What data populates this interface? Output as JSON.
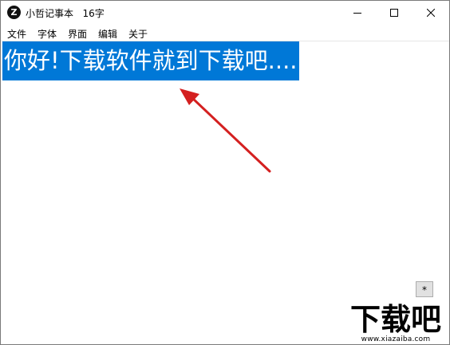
{
  "window": {
    "icon_letter": "Z",
    "title": "小哲记事本",
    "char_count": "16字"
  },
  "menu": [
    "文件",
    "字体",
    "界面",
    "编辑",
    "关于"
  ],
  "editor": {
    "selected_text": "你好!下载软件就到下载吧...."
  },
  "star_button": {
    "label": "*"
  },
  "watermark": {
    "logo_text": "下载吧",
    "url": "www.xiazaiba.com"
  },
  "colors": {
    "selection": "#0078d7",
    "arrow": "#d42020"
  }
}
